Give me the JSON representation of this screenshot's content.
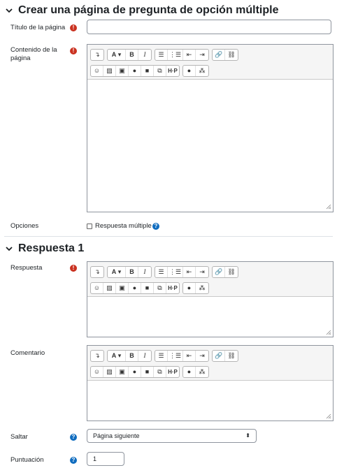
{
  "section1": {
    "title": "Crear una página de pregunta de opción múltiple"
  },
  "fields": {
    "titulo_label": "Título de la página",
    "contenido_label": "Contenido de la página",
    "opciones_label": "Opciones",
    "respuesta_multiple_label": "Respuesta múltiple"
  },
  "section2": {
    "title": "Respuesta 1"
  },
  "answer_fields": {
    "respuesta_label": "Respuesta",
    "comentario_label": "Comentario",
    "saltar_label": "Saltar",
    "saltar_value": "Página siguiente",
    "puntuacion_label": "Puntuación",
    "puntuacion_value": "1"
  },
  "toolbar": {
    "bold": "B",
    "italic": "I",
    "font": "A",
    "h5p": "H·P"
  },
  "colors": {
    "required": "#ca3120",
    "help": "#0f6cbf",
    "border": "#8f959e"
  }
}
